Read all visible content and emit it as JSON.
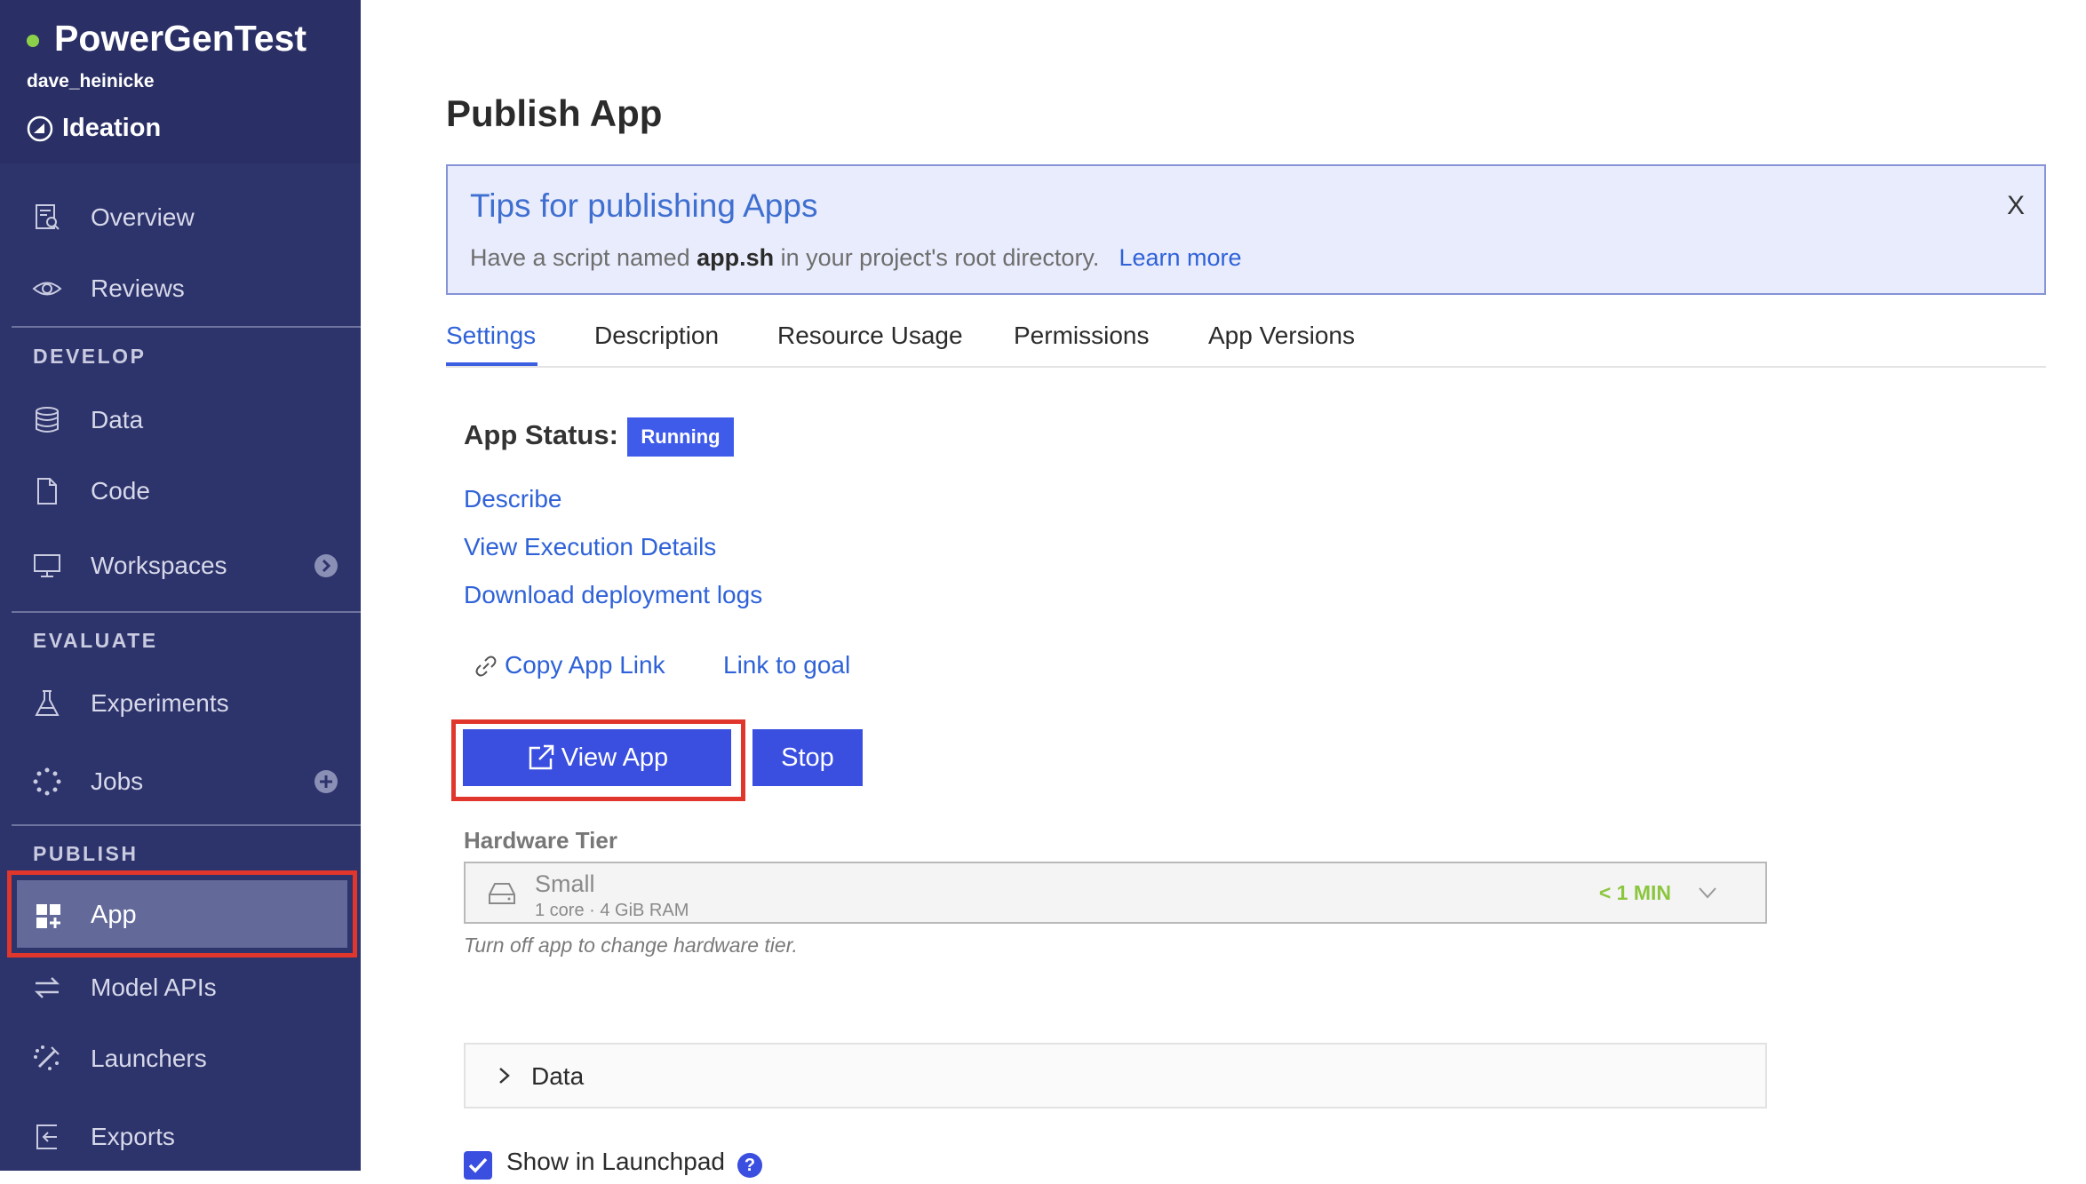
{
  "project": {
    "name": "PowerGenTest",
    "owner": "dave_heinicke",
    "stage": "Ideation"
  },
  "sidebar": {
    "top_items": [
      {
        "label": "Overview",
        "icon": "overview-icon"
      },
      {
        "label": "Reviews",
        "icon": "eye-icon"
      }
    ],
    "sections": [
      {
        "title": "DEVELOP",
        "items": [
          {
            "label": "Data",
            "icon": "database-icon"
          },
          {
            "label": "Code",
            "icon": "file-icon"
          },
          {
            "label": "Workspaces",
            "icon": "monitor-icon",
            "badge": "arrow-right-circle-icon"
          }
        ]
      },
      {
        "title": "EVALUATE",
        "items": [
          {
            "label": "Experiments",
            "icon": "flask-icon"
          },
          {
            "label": "Jobs",
            "icon": "spinner-icon",
            "badge": "plus-circle-icon"
          }
        ]
      },
      {
        "title": "PUBLISH",
        "items": [
          {
            "label": "App",
            "icon": "app-grid-icon",
            "active": true
          },
          {
            "label": "Model APIs",
            "icon": "swap-arrows-icon"
          },
          {
            "label": "Launchers",
            "icon": "launcher-icon"
          },
          {
            "label": "Exports",
            "icon": "export-icon"
          }
        ]
      }
    ]
  },
  "main": {
    "title": "Publish App",
    "tips": {
      "title": "Tips for publishing Apps",
      "body_prefix": "Have a script named ",
      "body_bold": "app.sh",
      "body_suffix": " in your project's root directory.",
      "link": "Learn more",
      "close": "X"
    },
    "tabs": [
      "Settings",
      "Description",
      "Resource Usage",
      "Permissions",
      "App Versions"
    ],
    "active_tab": "Settings",
    "status": {
      "label": "App Status:",
      "value": "Running"
    },
    "links": [
      "Describe",
      "View Execution Details",
      "Download deployment logs"
    ],
    "copy_link": "Copy App Link",
    "goal_link": "Link to goal",
    "view_button": "View App",
    "stop_button": "Stop",
    "hardware": {
      "label": "Hardware Tier",
      "name": "Small",
      "spec": "1 core · 4 GiB RAM",
      "time": "< 1 MIN",
      "note": "Turn off app to change hardware tier."
    },
    "data_section": "Data",
    "launchpad": {
      "label": "Show in Launchpad",
      "checked": true
    }
  },
  "colors": {
    "sidebar": "#2d336b",
    "accent": "#3a4ee0",
    "link": "#2f62d8",
    "highlight": "#e0362b",
    "running": "#3f5bea"
  }
}
